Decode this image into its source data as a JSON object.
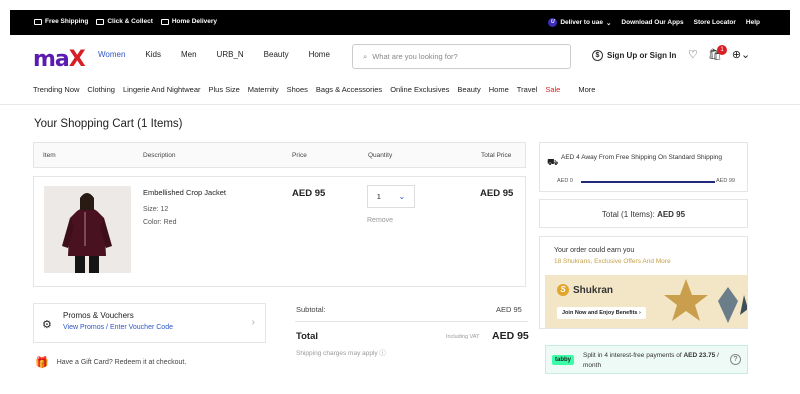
{
  "topbar": {
    "free_shipping": "Free Shipping",
    "click_collect": "Click & Collect",
    "home_delivery": "Home Delivery",
    "deliver_to": "Deliver to uae",
    "download_apps": "Download Our Apps",
    "store_locator": "Store Locator",
    "help": "Help"
  },
  "header": {
    "logo_text": "ma",
    "logo_x": "X",
    "nav": [
      "Women",
      "Kids",
      "Men",
      "URB_N",
      "Beauty",
      "Home"
    ],
    "search_placeholder": "What are you looking for?",
    "signin": "Sign Up or Sign In",
    "cart_count": "1",
    "brand_color": "#5b1bb0",
    "accent_color": "#2f55c6"
  },
  "categories": [
    "Trending Now",
    "Clothing",
    "Lingerie And Nightwear",
    "Plus Size",
    "Maternity",
    "Shoes",
    "Bags & Accessories",
    "Online Exclusives",
    "Beauty",
    "Home",
    "Travel",
    "Sale",
    "More"
  ],
  "cart": {
    "title": "Your Shopping Cart (1 Items)",
    "headers": {
      "item": "Item",
      "description": "Description",
      "price": "Price",
      "quantity": "Quantity",
      "total": "Total Price"
    },
    "product": {
      "name": "Embellished Crop Jacket",
      "size": "Size: 12",
      "color": "Color: Red",
      "price": "AED 95",
      "qty": "1",
      "remove": "Remove",
      "total": "AED 95"
    }
  },
  "promo": {
    "title": "Promos & Vouchers",
    "link": "View Promos / Enter Voucher Code"
  },
  "gift": "Have a Gift Card? Redeem it at checkout.",
  "summary": {
    "subtotal_label": "Subtotal:",
    "subtotal_value": "AED 95",
    "total_label": "Total",
    "including_vat": "Including VAT",
    "total_value": "AED 95",
    "shipping_note": "Shipping charges may apply"
  },
  "right": {
    "free_ship_text": "AED 4 Away From Free Shipping On Standard Shipping",
    "bar_start": "AED 0",
    "bar_end": "AED 99",
    "bar_progress": 0.96,
    "total_items_label": "Total (1 Items):",
    "total_items_value": "AED 95",
    "earn_1": "Your order could earn you",
    "earn_2": "18 Shukrans, Exclusive Offers And More",
    "shukran": "Shukran",
    "join_button": "Join Now and Enjoy Benefits",
    "tabby_logo": "tabby",
    "tabby_text_1": "Split in 4 interest-free payments of",
    "tabby_amount": "AED 23.75",
    "tabby_text_2": "/ month"
  }
}
